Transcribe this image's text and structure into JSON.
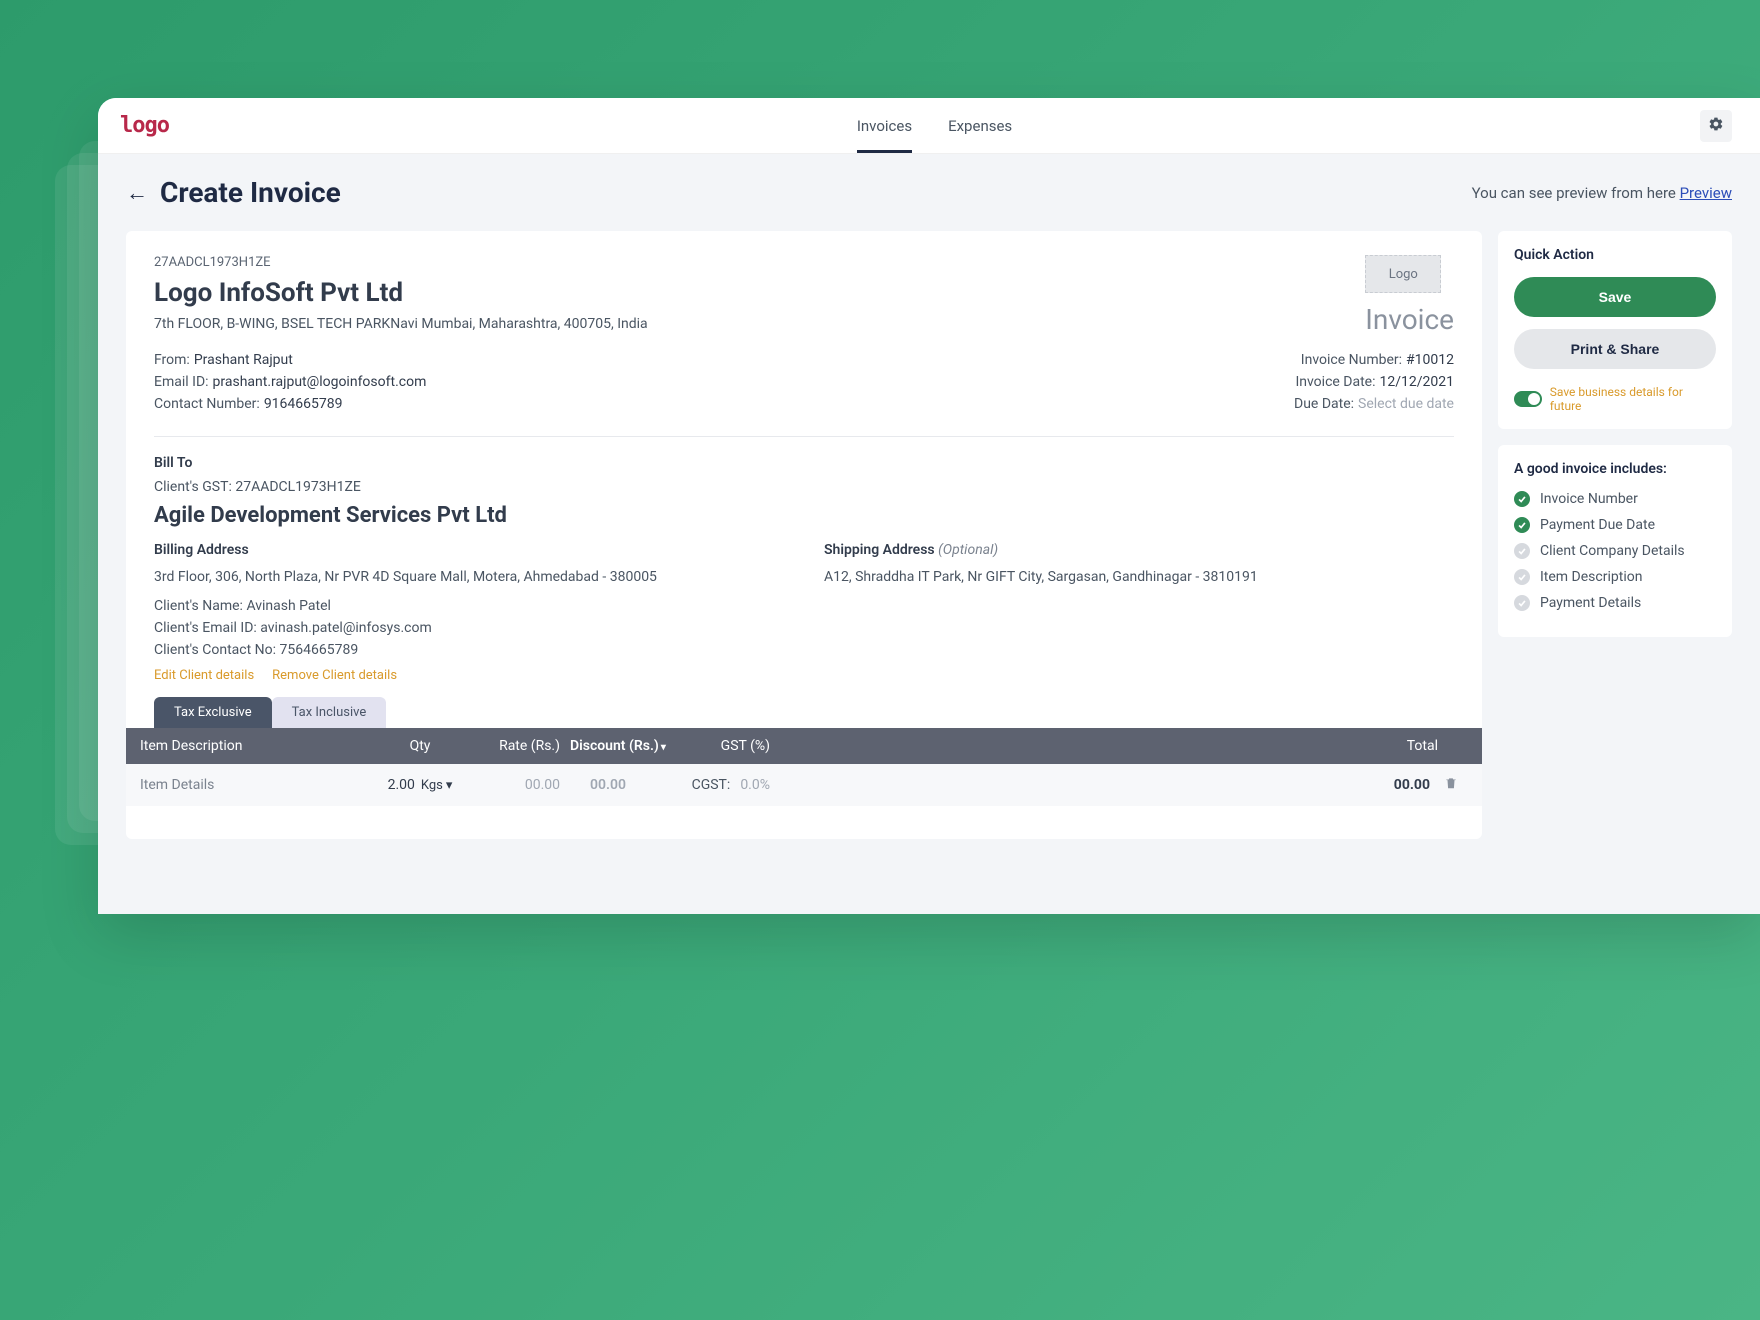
{
  "brand": "logo",
  "nav": {
    "invoices": "Invoices",
    "expenses": "Expenses"
  },
  "page": {
    "title": "Create Invoice",
    "preview_prefix": "You can see preview from here",
    "preview_link": "Preview"
  },
  "company": {
    "gst": "27AADCL1973H1ZE",
    "name": "Logo InfoSoft Pvt Ltd",
    "address": "7th FLOOR, B-WING, BSEL TECH PARKNavi Mumbai, Maharashtra, 400705, India",
    "logo_placeholder": "Logo"
  },
  "invoice": {
    "label": "Invoice",
    "number_label": "Invoice Number:",
    "number": "#10012",
    "date_label": "Invoice Date:",
    "date": "12/12/2021",
    "due_label": "Due Date:",
    "due_placeholder": "Select due date"
  },
  "from": {
    "label": "From:",
    "name": "Prashant Rajput",
    "email_label": "Email ID:",
    "email": "prashant.rajput@logoinfosoft.com",
    "contact_label": "Contact Number:",
    "contact": "9164665789"
  },
  "bill_to": {
    "title": "Bill To",
    "gst_label": "Client's GST:",
    "gst": "27AADCL1973H1ZE",
    "name": "Agile Development Services Pvt Ltd"
  },
  "billing_address": {
    "title": "Billing Address",
    "text": "3rd Floor, 306, North Plaza, Nr PVR 4D Square Mall, Motera, Ahmedabad - 380005"
  },
  "shipping_address": {
    "title": "Shipping Address",
    "optional": "(Optional)",
    "text": "A12, Shraddha IT Park, Nr GIFT City, Sargasan, Gandhinagar - 3810191"
  },
  "client_contact": {
    "name_label": "Client's Name:",
    "name": "Avinash Patel",
    "email_label": "Client's Email ID:",
    "email": "avinash.patel@infosys.com",
    "phone_label": "Client's Contact No:",
    "phone": "7564665789"
  },
  "client_actions": {
    "edit": "Edit Client details",
    "remove": "Remove Client details"
  },
  "tax_tabs": {
    "exclusive": "Tax Exclusive",
    "inclusive": "Tax Inclusive"
  },
  "table": {
    "headers": {
      "desc": "Item Description",
      "qty": "Qty",
      "rate": "Rate (Rs.)",
      "discount": "Discount (Rs.)",
      "gst": "GST (%)",
      "total": "Total"
    },
    "row": {
      "desc_placeholder": "Item Details",
      "qty": "2.00",
      "unit": "Kgs",
      "rate": "00.00",
      "discount": "00.00",
      "gst_label": "CGST:",
      "gst_val": "0.0%",
      "total": "00.00"
    }
  },
  "quick_action": {
    "title": "Quick Action",
    "save": "Save",
    "print": "Print & Share",
    "toggle_label": "Save business details for future"
  },
  "checklist": {
    "title": "A good invoice includes:",
    "items": [
      {
        "label": "Invoice Number",
        "done": true
      },
      {
        "label": "Payment Due Date",
        "done": true
      },
      {
        "label": "Client Company Details",
        "done": false
      },
      {
        "label": "Item Description",
        "done": false
      },
      {
        "label": "Payment Details",
        "done": false
      }
    ]
  }
}
